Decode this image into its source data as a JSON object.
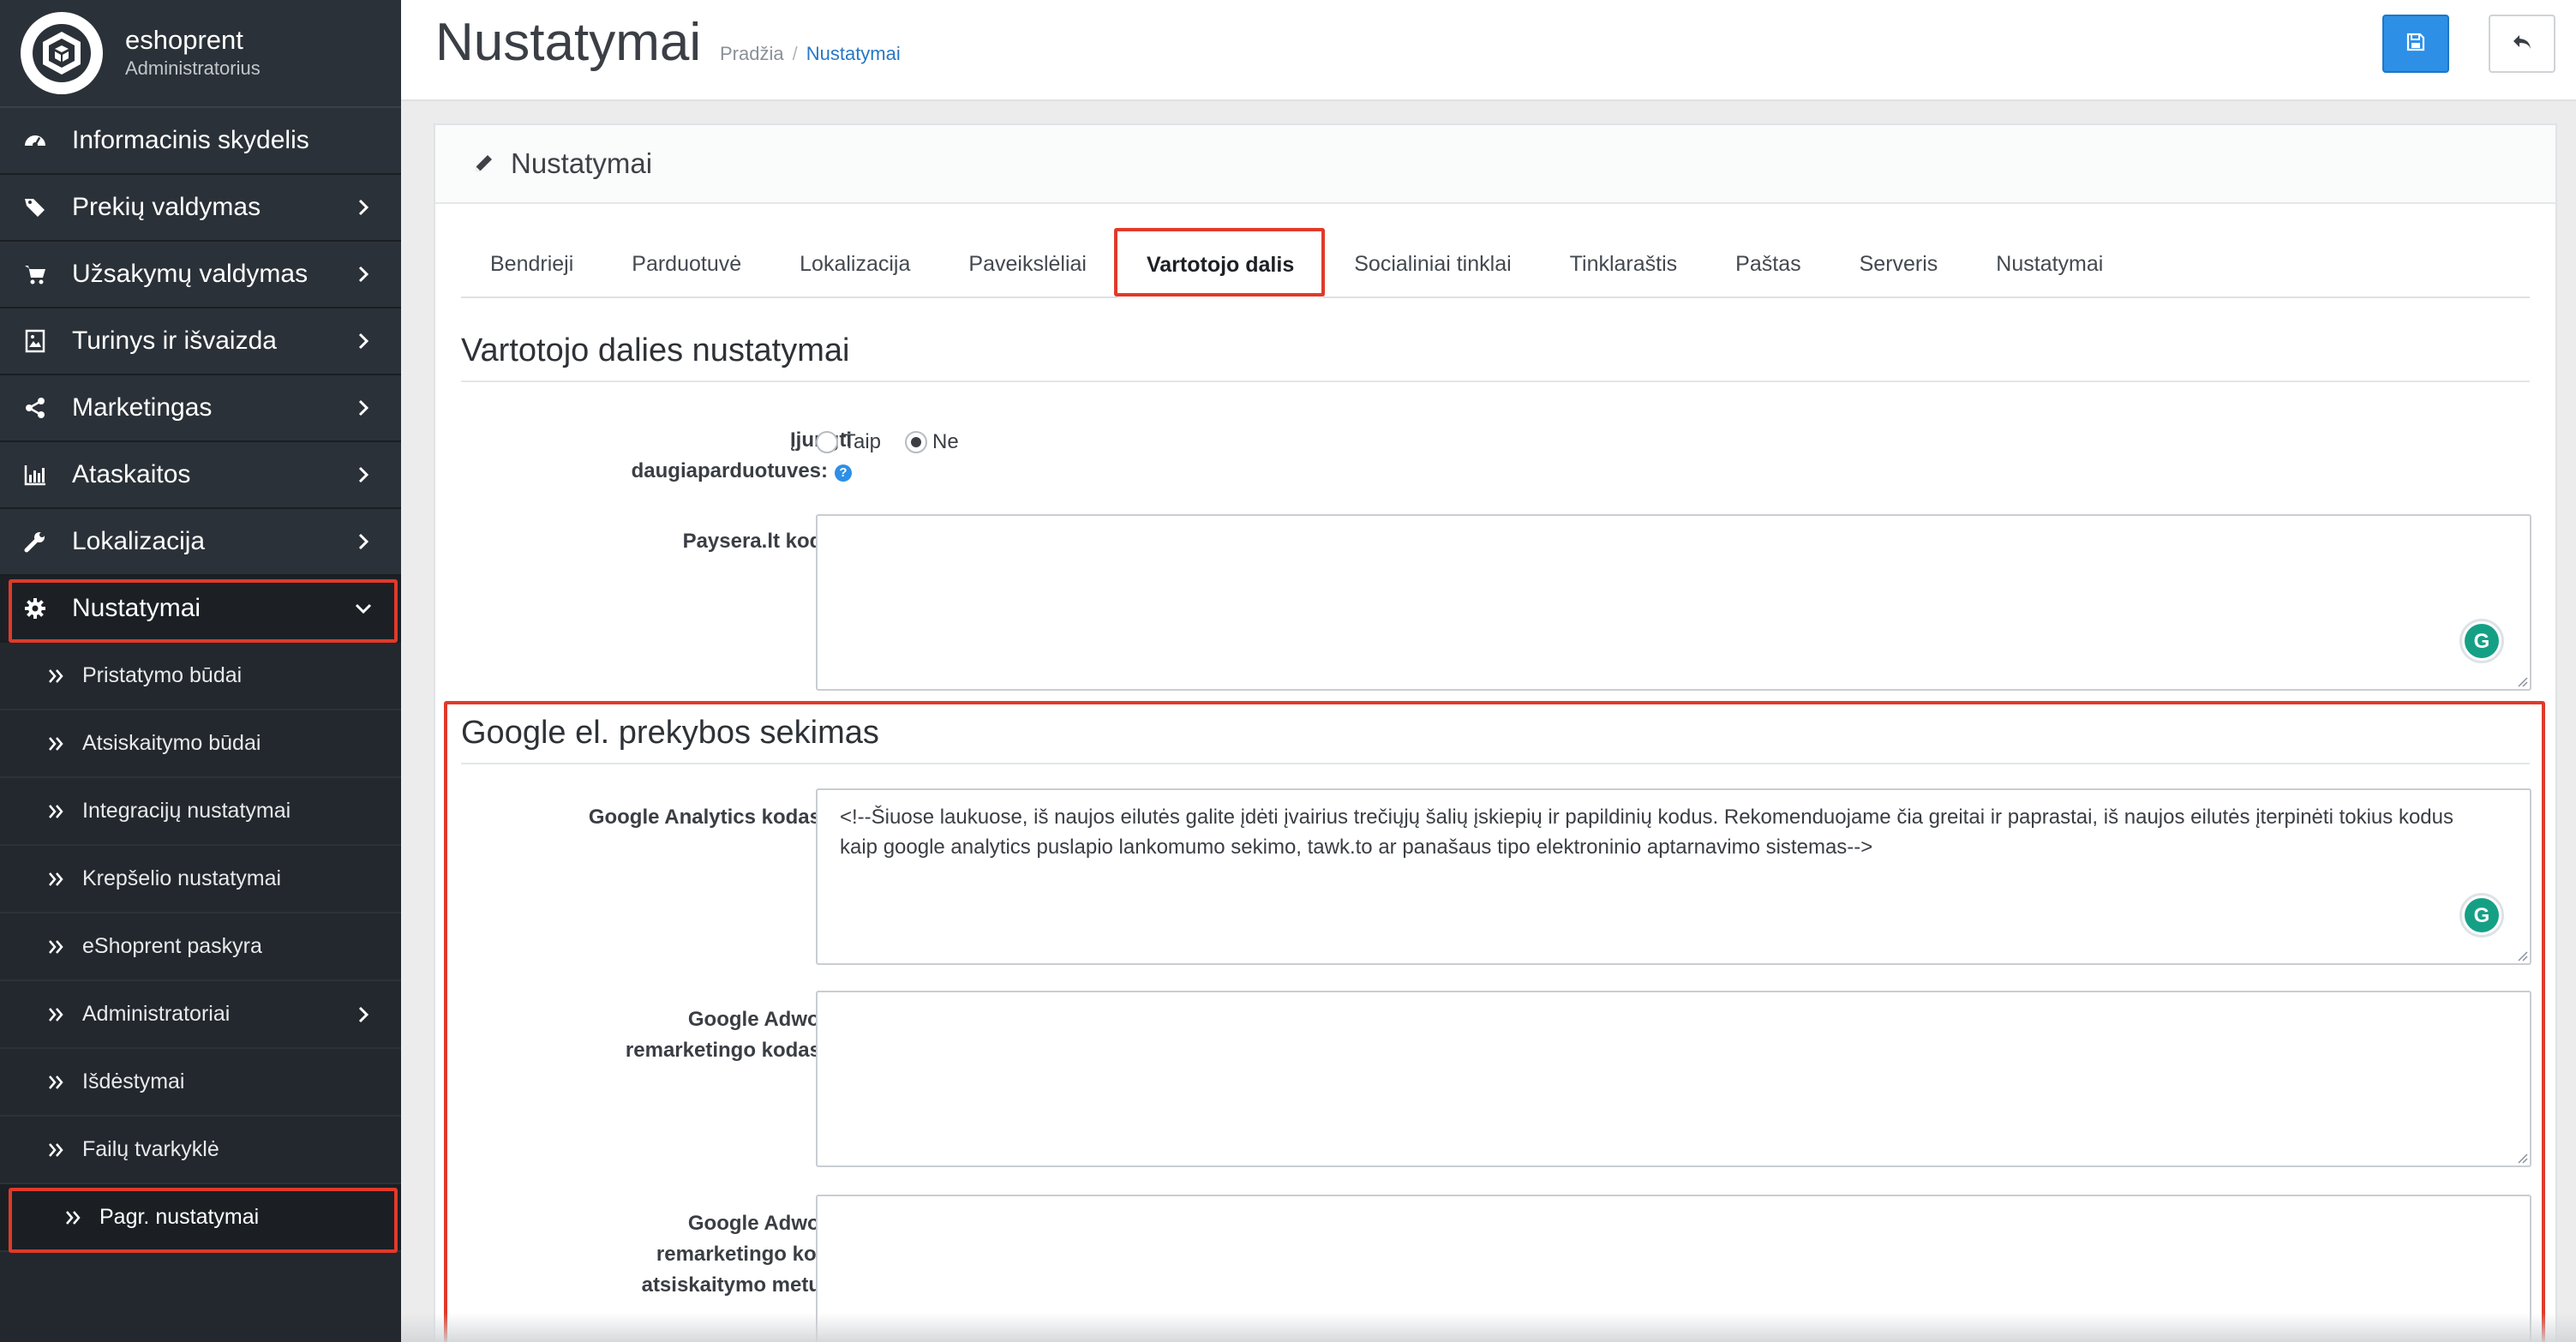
{
  "brand": {
    "name": "eshoprent",
    "role": "Administratorius"
  },
  "sidebar": {
    "items": [
      {
        "label": "Informacinis skydelis",
        "icon": "dashboard-icon"
      },
      {
        "label": "Prekių valdymas",
        "icon": "tags-icon"
      },
      {
        "label": "Užsakymų valdymas",
        "icon": "cart-icon"
      },
      {
        "label": "Turinys ir išvaizda",
        "icon": "image-icon"
      },
      {
        "label": "Marketingas",
        "icon": "share-icon"
      },
      {
        "label": "Ataskaitos",
        "icon": "bar-chart-icon"
      },
      {
        "label": "Lokalizacija",
        "icon": "wrench-icon"
      },
      {
        "label": "Nustatymai",
        "icon": "gear-icon"
      }
    ],
    "sub_items": [
      "Pristatymo būdai",
      "Atsiskaitymo būdai",
      "Integracijų nustatymai",
      "Krepšelio nustatymai",
      "eShoprent paskyra",
      "Administratoriai",
      "Išdėstymai",
      "Failų tvarkyklė",
      "Pagr. nustatymai"
    ]
  },
  "header": {
    "title": "Nustatymai",
    "breadcrumb": [
      "Pradžia",
      "/",
      "Nustatymai"
    ]
  },
  "panel": {
    "title": "Nustatymai",
    "tabs": [
      "Bendrieji",
      "Parduotuvė",
      "Lokalizacija",
      "Paveikslėliai",
      "Vartotojo dalis",
      "Socialiniai tinklai",
      "Tinklaraštis",
      "Paštas",
      "Serveris",
      "Nustatymai"
    ],
    "active_tab": "Vartotojo dalis"
  },
  "section1": {
    "title": "Vartotojo dalies nustatymai",
    "multistore_label_line1": "Įjungti",
    "multistore_label_line2": "daugiaparduotuves:",
    "radio_yes": "Taip",
    "radio_no": "Ne",
    "radio_selected": "Ne",
    "paysera_label": "Paysera.lt kodas:",
    "paysera_value": ""
  },
  "section2": {
    "title": "Google el. prekybos sekimas",
    "ga_label": "Google Analytics kodas:",
    "ga_value": "<!--Šiuose laukuose, iš naujos eilutės galite įdėti įvairius trečiųjų šalių įskiepių ir papildinių kodus. Rekomenduojame čia greitai ir paprastai, iš naujos eilutės įterpinėti tokius kodus kaip google analytics puslapio lankomumo sekimo, tawk.to ar panašaus tipo elektroninio aptarnavimo sistemas-->",
    "adwords_label_line1": "Google Adwords",
    "adwords_label_line2": "remarketingo kodas:",
    "adwords_checkout_line1": "Google Adwords",
    "adwords_checkout_line2": "remarketingo kodas",
    "adwords_checkout_line3": "atsiskaitymo metu:"
  },
  "colors": {
    "accent": "#2d8fe6",
    "highlight": "#e03a2a",
    "sidebar": "#23282e",
    "grammarly": "#15a085"
  }
}
